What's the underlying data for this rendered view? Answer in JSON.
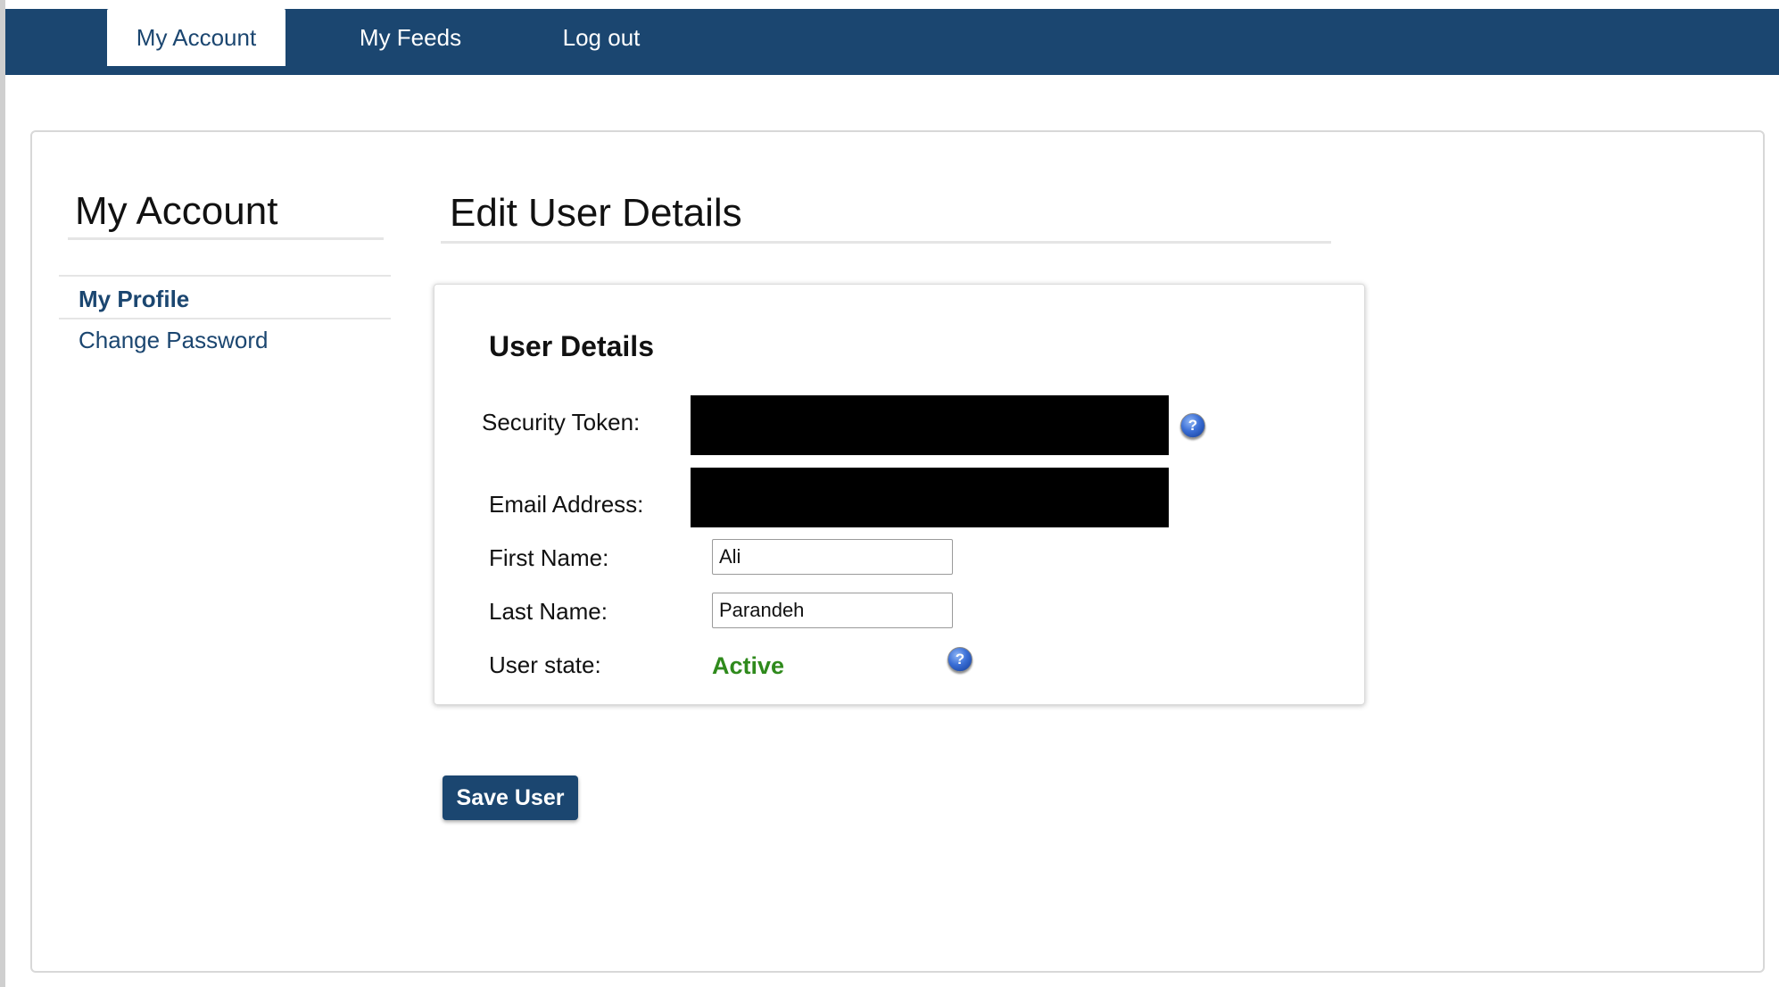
{
  "nav": {
    "tabs": [
      {
        "label": "My Account",
        "active": true
      },
      {
        "label": "My Feeds",
        "active": false
      },
      {
        "label": "Log out",
        "active": false
      }
    ],
    "background_color": "#1b4670"
  },
  "sidebar": {
    "title": "My Account",
    "items": [
      {
        "label": "My Profile",
        "selected": true
      },
      {
        "label": "Change Password",
        "selected": false
      }
    ]
  },
  "main": {
    "title": "Edit User Details",
    "card": {
      "heading": "User Details",
      "fields": {
        "security_token": {
          "label": "Security Token:",
          "redacted": true
        },
        "email": {
          "label": "Email Address:",
          "redacted": true
        },
        "first_name": {
          "label": "First Name:",
          "value": "Ali"
        },
        "last_name": {
          "label": "Last Name:",
          "value": "Parandeh"
        },
        "user_state": {
          "label": "User state:",
          "value": "Active",
          "color": "#2f8a1c"
        }
      },
      "help_icon": {
        "glyph": "?",
        "name": "help-icon"
      }
    },
    "save_button": "Save User"
  }
}
